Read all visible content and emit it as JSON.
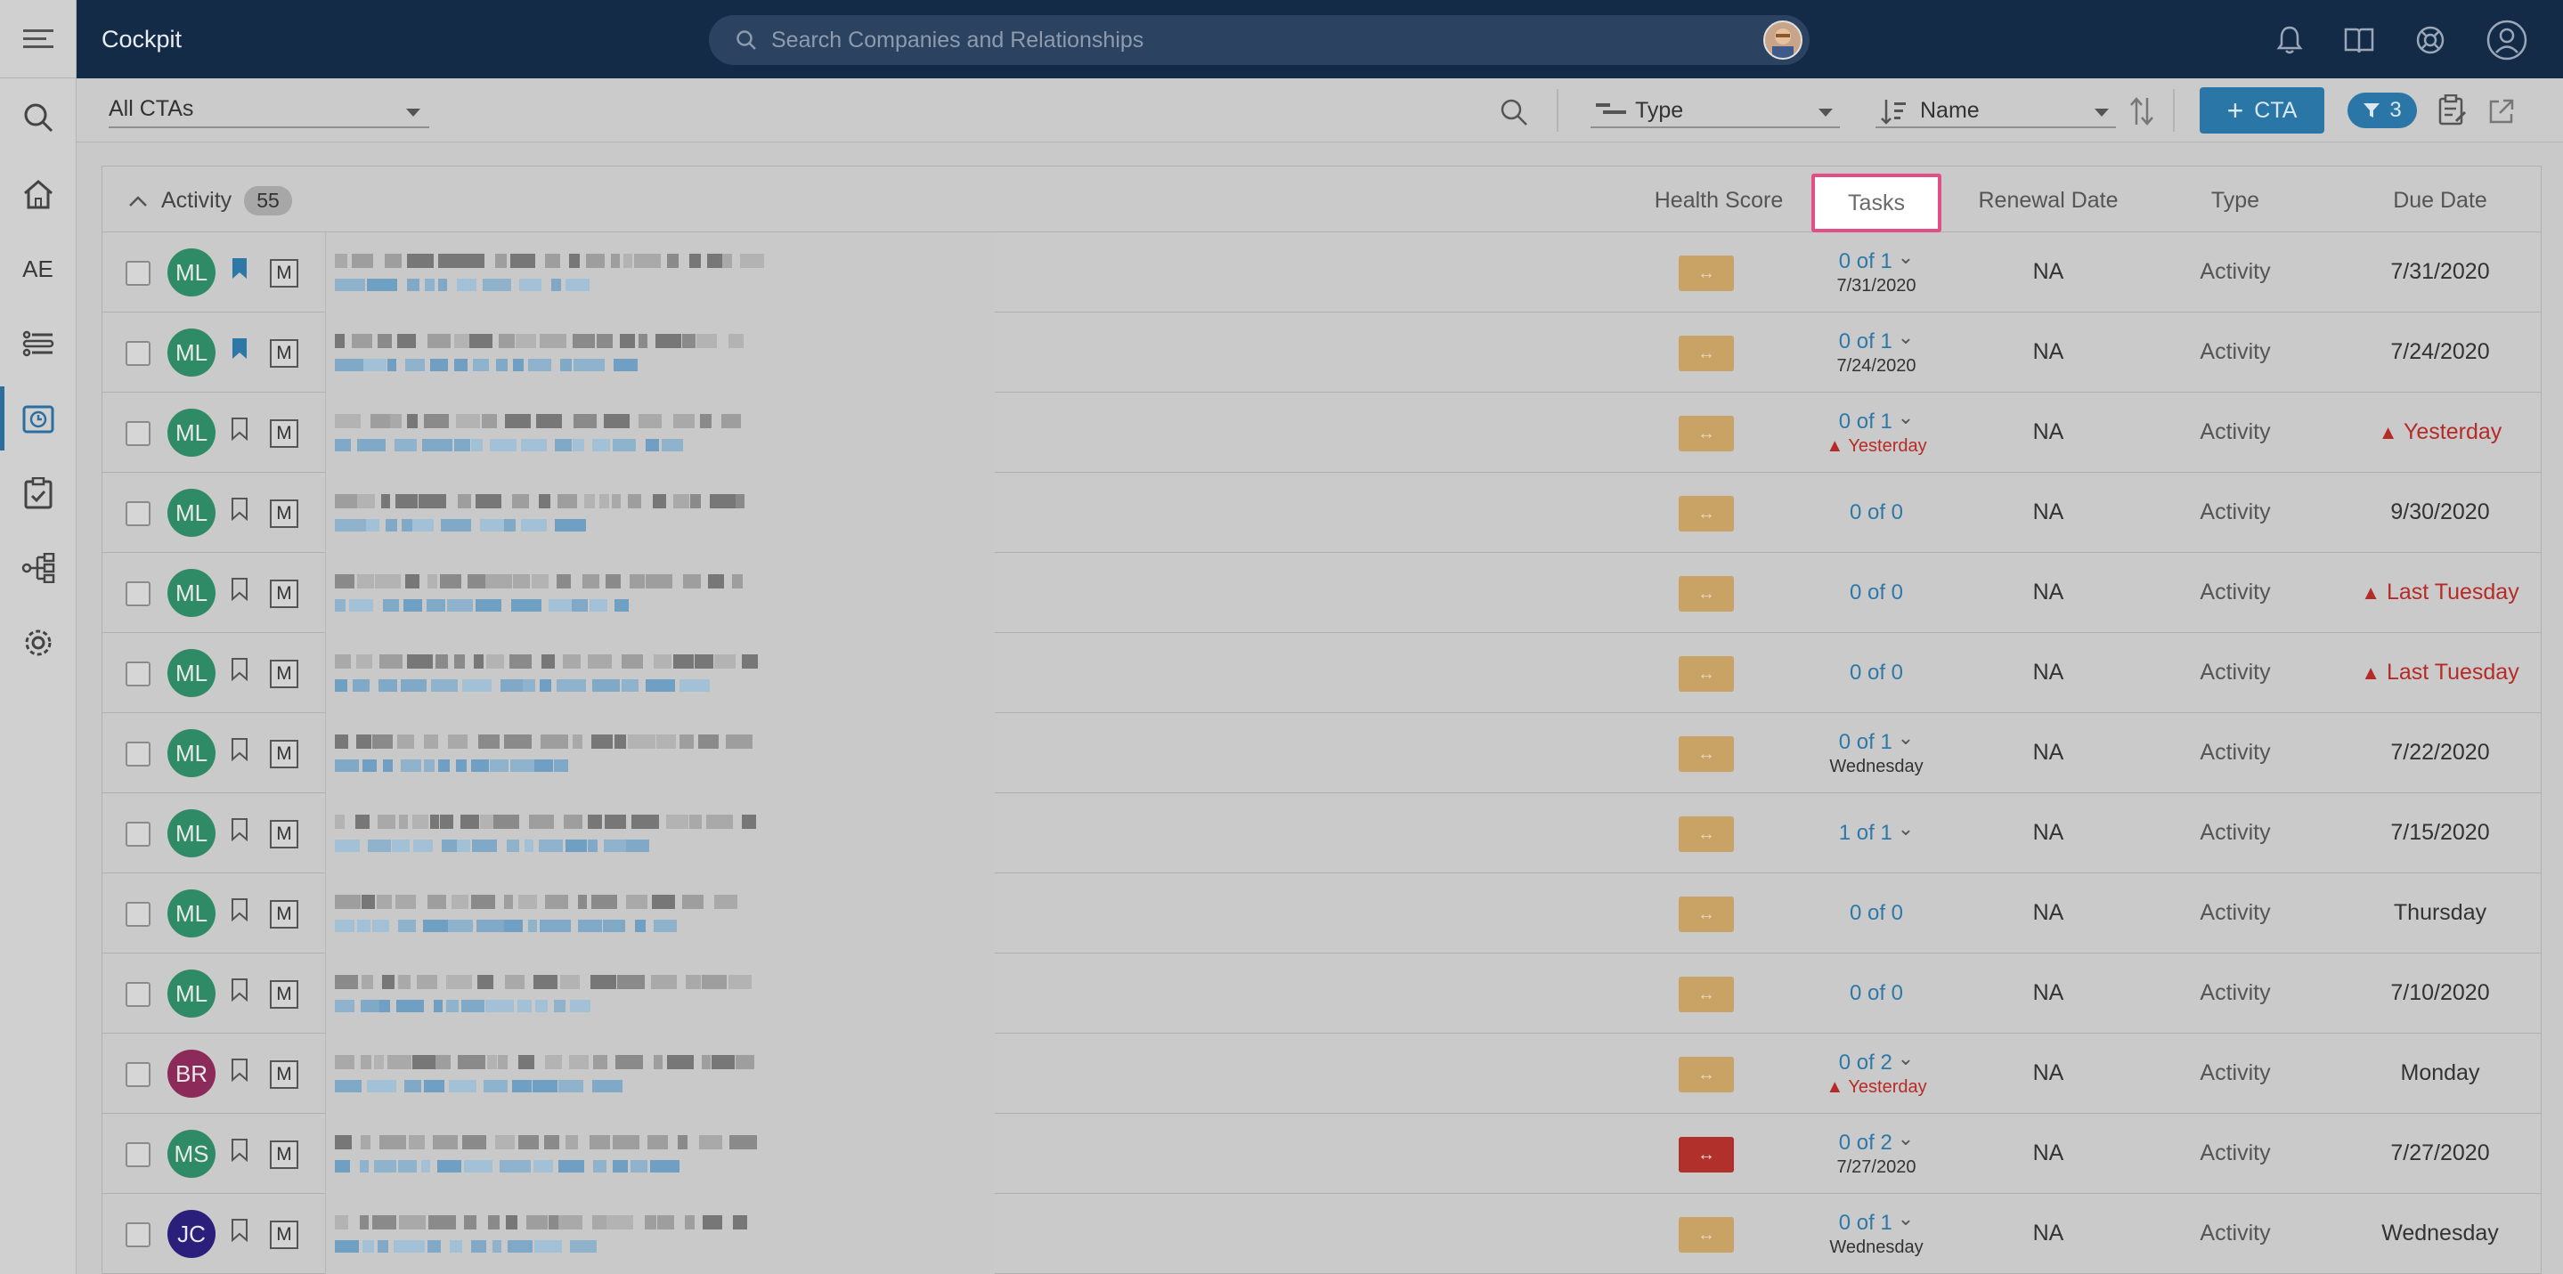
{
  "app": {
    "title": "Cockpit"
  },
  "search": {
    "placeholder": "Search Companies and Relationships"
  },
  "rail": {
    "account_label": "AE"
  },
  "toolbar": {
    "view": "All CTAs",
    "group_by": "Type",
    "sort_by": "Name",
    "cta_label": "CTA",
    "filter_count": "3"
  },
  "table": {
    "group": {
      "label": "Activity",
      "count": "55"
    },
    "headers": {
      "health_score": "Health Score",
      "tasks": "Tasks",
      "renewal_date": "Renewal Date",
      "type": "Type",
      "due_date": "Due Date"
    },
    "rows": [
      {
        "initials": "ML",
        "bookmarked": true,
        "m": "M",
        "hs": "↔",
        "tasks": "0 of 1",
        "chev": "⌄",
        "tasks_sub": "7/31/2020",
        "renewal": "NA",
        "type": "Activity",
        "due": "7/31/2020",
        "due_warn": ""
      },
      {
        "initials": "ML",
        "bookmarked": true,
        "m": "M",
        "hs": "↔",
        "tasks": "0 of 1",
        "chev": "⌄",
        "tasks_sub": "7/24/2020",
        "renewal": "NA",
        "type": "Activity",
        "due": "7/24/2020",
        "due_warn": ""
      },
      {
        "initials": "ML",
        "bookmarked": false,
        "m": "M",
        "hs": "↔",
        "tasks": "0 of 1",
        "chev": "⌄",
        "tasks_sub": "Yesterday",
        "tasks_sub_warn": "▲",
        "renewal": "NA",
        "type": "Activity",
        "due": "Yesterday",
        "due_warn": "▲"
      },
      {
        "initials": "ML",
        "bookmarked": false,
        "m": "M",
        "hs": "↔",
        "tasks": "0 of 0",
        "chev": "",
        "tasks_sub": "",
        "renewal": "NA",
        "type": "Activity",
        "due": "9/30/2020",
        "due_warn": ""
      },
      {
        "initials": "ML",
        "bookmarked": false,
        "m": "M",
        "hs": "↔",
        "tasks": "0 of 0",
        "chev": "",
        "tasks_sub": "",
        "renewal": "NA",
        "type": "Activity",
        "due": "Last Tuesday",
        "due_warn": "▲"
      },
      {
        "initials": "ML",
        "bookmarked": false,
        "m": "M",
        "hs": "↔",
        "tasks": "0 of 0",
        "chev": "",
        "tasks_sub": "",
        "renewal": "NA",
        "type": "Activity",
        "due": "Last Tuesday",
        "due_warn": "▲"
      },
      {
        "initials": "ML",
        "bookmarked": false,
        "m": "M",
        "hs": "↔",
        "tasks": "0 of 1",
        "chev": "⌄",
        "tasks_sub": "Wednesday",
        "renewal": "NA",
        "type": "Activity",
        "due": "7/22/2020",
        "due_warn": ""
      },
      {
        "initials": "ML",
        "bookmarked": false,
        "m": "M",
        "hs": "↔",
        "tasks": "1 of 1",
        "chev": "⌄",
        "tasks_sub": "",
        "renewal": "NA",
        "type": "Activity",
        "due": "7/15/2020",
        "due_warn": ""
      },
      {
        "initials": "ML",
        "bookmarked": false,
        "m": "M",
        "hs": "↔",
        "tasks": "0 of 0",
        "chev": "",
        "tasks_sub": "",
        "renewal": "NA",
        "type": "Activity",
        "due": "Thursday",
        "due_warn": ""
      },
      {
        "initials": "ML",
        "bookmarked": false,
        "m": "M",
        "hs": "↔",
        "tasks": "0 of 0",
        "chev": "",
        "tasks_sub": "",
        "renewal": "NA",
        "type": "Activity",
        "due": "7/10/2020",
        "due_warn": ""
      },
      {
        "initials": "BR",
        "bookmarked": false,
        "m": "M",
        "hs": "↔",
        "tasks": "0 of 2",
        "chev": "⌄",
        "tasks_sub": "Yesterday",
        "tasks_sub_warn": "▲",
        "renewal": "NA",
        "type": "Activity",
        "due": "Monday",
        "due_warn": ""
      },
      {
        "initials": "MS",
        "bookmarked": false,
        "m": "M",
        "hs": "↔",
        "hs_red": true,
        "tasks": "0 of 2",
        "chev": "⌄",
        "tasks_sub": "7/27/2020",
        "renewal": "NA",
        "type": "Activity",
        "due": "7/27/2020",
        "due_warn": ""
      },
      {
        "initials": "JC",
        "bookmarked": false,
        "m": "M",
        "hs": "↔",
        "tasks": "0 of 1",
        "chev": "⌄",
        "tasks_sub": "Wednesday",
        "renewal": "NA",
        "type": "Activity",
        "due": "Wednesday",
        "due_warn": ""
      }
    ]
  },
  "colors": {
    "topbar": "#142b47",
    "accent": "#2a76a6",
    "avatar_ml": "#2f8a66",
    "avatar_br": "#8c2a5a",
    "avatar_ms": "#2f8a66",
    "avatar_jc": "#2a1f7a",
    "overdue": "#b62b27",
    "highlight_border": "#e04f86"
  }
}
